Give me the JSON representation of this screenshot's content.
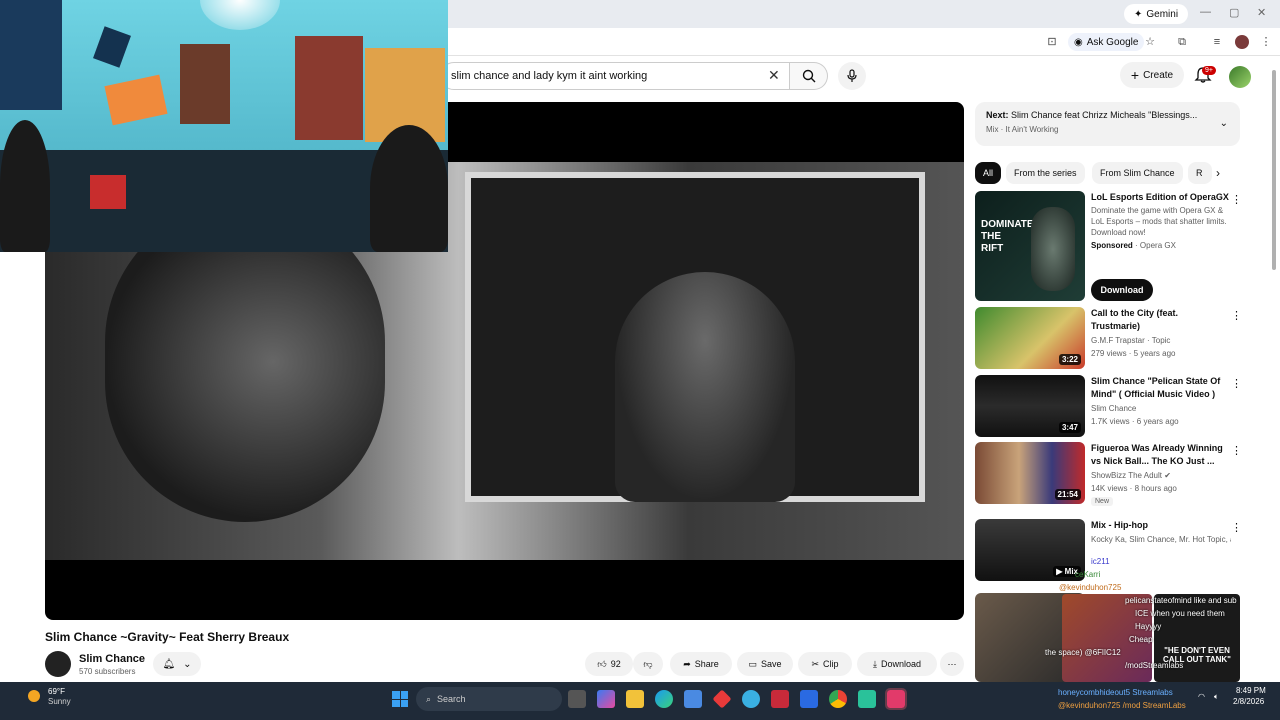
{
  "browser": {
    "gemini_label": "Gemini",
    "ask_google_label": "Ask Google"
  },
  "youtube": {
    "search_value": "slim chance and lady kym it aint working",
    "create_label": "Create",
    "notifications_badge": "9+"
  },
  "video": {
    "title": "Slim Chance ~Gravity~ Feat Sherry Breaux",
    "channel_name": "Slim Chance",
    "subscribers": "570 subscribers",
    "likes": "92",
    "share_label": "Share",
    "save_label": "Save",
    "clip_label": "Clip",
    "download_label": "Download"
  },
  "next_up": {
    "prefix": "Next:",
    "title": "Slim Chance feat Chrizz Micheals \"Blessings...",
    "subtitle": "Mix · It Ain't Working"
  },
  "chips": [
    "All",
    "From the series",
    "From Slim Chance",
    "R"
  ],
  "recommendations": [
    {
      "title": "LoL Esports Edition of OperaGX",
      "desc": "Dominate the game with Opera GX & LoL Esports – mods that shatter limits. Download now!",
      "sponsor_label": "Sponsored",
      "sponsor_name": "Opera GX",
      "cta": "Download",
      "thumb_text": "DOMINATE THE RIFT"
    },
    {
      "title": "Call to the City (feat. Trustmarie)",
      "channel": "G.M.F Trapstar · Topic",
      "meta": "279 views · 5 years ago",
      "duration": "3:22"
    },
    {
      "title": "Slim Chance \"Pelican State Of Mind\" ( Official Music Video )",
      "channel": "Slim Chance",
      "meta": "1.7K views · 6 years ago",
      "duration": "3:47"
    },
    {
      "title": "Figueroa Was Already Winning vs Nick Ball... The KO Just ...",
      "channel": "ShowBizz The Adult",
      "meta": "14K views · 8 hours ago",
      "badge": "New",
      "duration": "21:54"
    },
    {
      "title": "Mix - Hip-hop",
      "channel": "Kocky Ka, Slim Chance, Mr. Hot Topic, an...",
      "duration": "Mix"
    }
  ],
  "chat": [
    "ic211",
    "ceKarri",
    "@kevinduhon725",
    "pelicanstateofmind like and sub",
    "ICE when you need them",
    "Hayyyy",
    "Cheap",
    "the space) @6FlIC12",
    "/modStreamlabs",
    "honeycombhideout5   Streamlabs",
    "@kevinduhon725   /mod StreamLabs"
  ],
  "chat_thumb_text": "\"HE DON'T EVEN CALL OUT TANK\"",
  "taskbar": {
    "temp": "69°F",
    "weather": "Sunny",
    "search_label": "Search",
    "time": "8:49 PM",
    "date": "2/8/2026"
  },
  "colors": {
    "yt_red": "#cc0000",
    "chip_active": "#0f0f0f",
    "taskbar": "#1f2a38",
    "webcam_wall": "#5ec3d6"
  }
}
